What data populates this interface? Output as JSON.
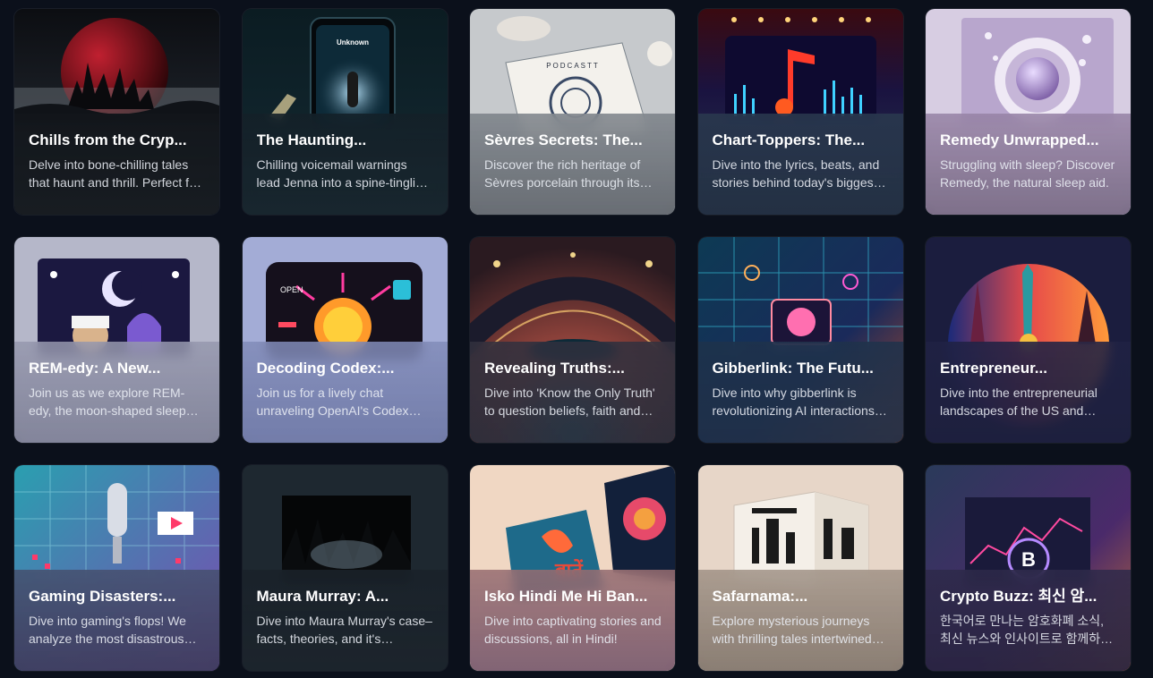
{
  "cards": [
    {
      "title": "Chills from the Cryp...",
      "description": "Delve into bone-chilling tales that haunt and thrill. Perfect for fans of the macabre.",
      "cover_icon": "blood-moon-castle-art",
      "accent": "#1b1f26"
    },
    {
      "title": "The Haunting...",
      "description": "Chilling voicemail warnings lead Jenna into a spine-tingling mystery.",
      "cover_icon": "phone-unknown-caller-art",
      "cover_text": "Unknown",
      "accent": "#1a2a33"
    },
    {
      "title": "Sèvres Secrets: The...",
      "description": "Discover the rich heritage of Sèvres porcelain through its history.",
      "cover_icon": "porcelain-book-art",
      "cover_text": "PODCASTT",
      "accent": "#c9ccd0"
    },
    {
      "title": "Chart-Toppers: The...",
      "description": "Dive into the lyrics, beats, and stories behind today's biggest hits.",
      "cover_icon": "music-note-stage-art",
      "accent": "#2a3a4f"
    },
    {
      "title": "Remedy Unwrapped...",
      "description": "Struggling with sleep? Discover Remedy, the natural sleep aid.",
      "cover_icon": "lavender-remedy-art",
      "accent": "#d9cfe0"
    },
    {
      "title": "REM-edy: A New...",
      "description": "Join us as we explore REM-edy, the moon-shaped sleep companion.",
      "cover_icon": "moon-podcast-art",
      "accent": "#9fa0b8"
    },
    {
      "title": "Decoding Codex:...",
      "description": "Join us for a lively chat unraveling OpenAI's Codex capabilities.",
      "cover_icon": "open-codex-brain-art",
      "cover_text": "OPEN",
      "accent": "#a3acd6"
    },
    {
      "title": "Revealing Truths:...",
      "description": "Dive into 'Know the Only Truth' to question beliefs, faith and more.",
      "cover_icon": "cosmic-eye-art",
      "accent": "#2a2e3d"
    },
    {
      "title": "Gibberlink: The Futu...",
      "description": "Dive into why gibberlink is revolutionizing AI interactions today.",
      "cover_icon": "circuit-brain-art",
      "accent": "#1f2f47"
    },
    {
      "title": "Entrepreneur...",
      "description": "Dive into the entrepreneurial landscapes of the US and France.",
      "cover_icon": "liberty-eiffel-art",
      "accent": "#1d2140"
    },
    {
      "title": "Gaming Disasters:...",
      "description": "Dive into gaming's flops! We analyze the most disastrous releases.",
      "cover_icon": "gaming-microphone-art",
      "accent": "#3c3a55"
    },
    {
      "title": "Maura Murray: A...",
      "description": "Dive into Maura Murray's case–facts, theories, and it's aftermath.",
      "cover_icon": "dark-forest-art",
      "accent": "#1c252e"
    },
    {
      "title": "Isko Hindi Me Hi Ban...",
      "description": "Dive into captivating stories and discussions, all in Hindi!",
      "cover_icon": "hindi-books-art",
      "cover_text": "बातें",
      "accent": "#6b5a66"
    },
    {
      "title": "Safarnama:...",
      "description": "Explore mysterious journeys with thrilling tales intertwined with culture.",
      "cover_icon": "safarnama-cube-art",
      "accent": "#b8a898"
    },
    {
      "title": "Crypto Buzz: 최신 암...",
      "description": "한국어로 만나는 암호화폐 소식, 최신 뉴스와 인사이트로 함께하세요.",
      "cover_icon": "bitcoin-chart-art",
      "accent": "#2e2a4a"
    }
  ]
}
